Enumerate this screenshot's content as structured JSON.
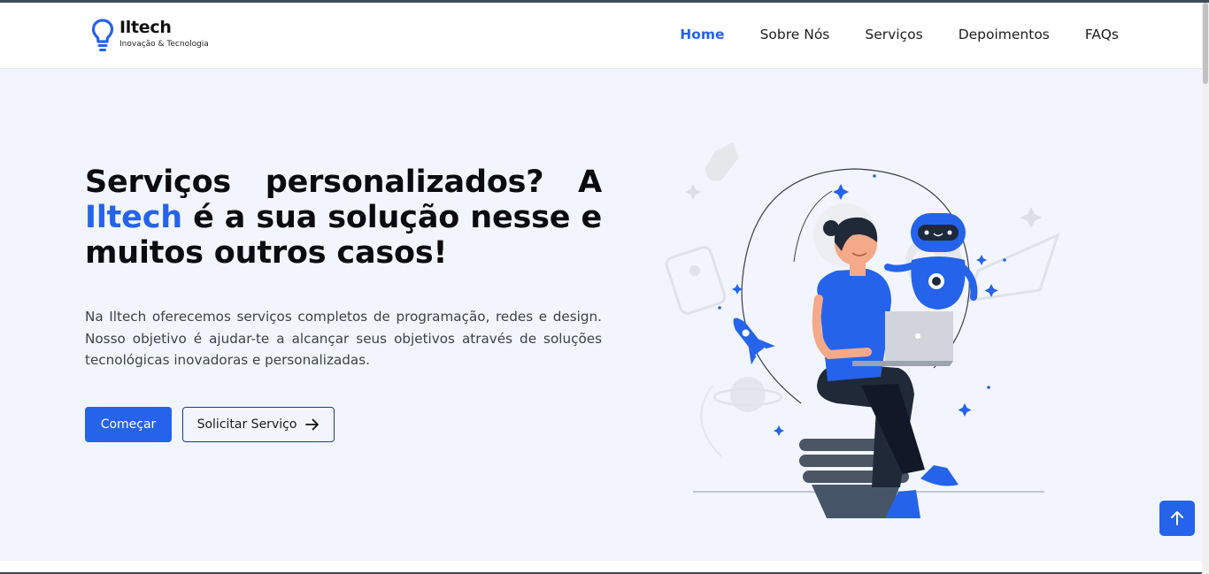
{
  "brand": {
    "name": "Iltech",
    "tagline": "Inovação & Tecnologia",
    "icon": "lightbulb-icon"
  },
  "nav": {
    "items": [
      {
        "label": "Home",
        "active": true
      },
      {
        "label": "Sobre Nós",
        "active": false
      },
      {
        "label": "Serviços",
        "active": false
      },
      {
        "label": "Depoimentos",
        "active": false
      },
      {
        "label": "FAQs",
        "active": false
      }
    ]
  },
  "hero": {
    "headline_part1": "Serviços personalizados? A",
    "headline_brand": "Iltech",
    "headline_part2": " é a sua solução nesse e muitos outros casos!",
    "description": "Na Iltech oferecemos serviços completos de programação, redes e design. Nosso objetivo é ajudar-te a alcançar seus objetivos através de soluções tecnológicas inovadoras e personalizadas.",
    "primary_button": "Começar",
    "secondary_button": "Solicitar Serviço",
    "secondary_icon": "arrow-right-icon",
    "illustration": "woman-laptop-robot-illustration"
  },
  "back_to_top": {
    "icon": "arrow-up-icon"
  },
  "colors": {
    "accent": "#2563eb",
    "hero_background": "#f2f5fd",
    "heading": "#0b0b0f",
    "body_text": "#3d4148"
  }
}
